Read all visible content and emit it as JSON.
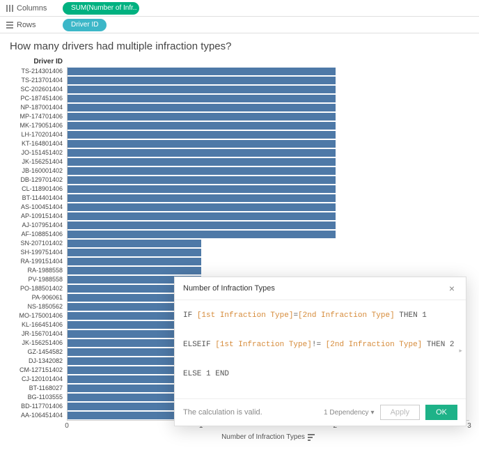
{
  "shelves": {
    "columns_label": "Columns",
    "rows_label": "Rows",
    "columns_pill": "SUM(Number of Infr..",
    "rows_pill": "Driver ID"
  },
  "viz": {
    "title": "How many drivers had multiple infraction types?",
    "y_header": "Driver ID",
    "x_label": "Number of Infraction Types"
  },
  "x_axis": {
    "ticks": [
      "0",
      "1",
      "2",
      "3"
    ],
    "max": 3
  },
  "chart_data": {
    "type": "bar",
    "xlabel": "Number of Infraction Types",
    "ylabel": "Driver ID",
    "xlim": [
      0,
      3
    ],
    "categories": [
      "TS-214301406",
      "TS-213701404",
      "SC-202601404",
      "PC-187451406",
      "NP-187001404",
      "MP-174701406",
      "MK-179051406",
      "LH-170201404",
      "KT-164801404",
      "JO-151451402",
      "JK-156251404",
      "JB-160001402",
      "DB-129701402",
      "CL-118901406",
      "BT-114401404",
      "AS-100451404",
      "AP-109151404",
      "AJ-107951404",
      "AF-108851406",
      "SN-207101402",
      "SH-199751404",
      "RA-199151404",
      "RA-1988558",
      "PV-1988558",
      "PO-188501402",
      "PA-906061",
      "NS-1850562",
      "MO-175001406",
      "KL-166451406",
      "JR-156701404",
      "JK-156251406",
      "GZ-1454582",
      "DJ-1342082",
      "CM-127151402",
      "CJ-120101404",
      "BT-1168027",
      "BG-1103555",
      "BD-117701406",
      "AA-106451404"
    ],
    "values": [
      2,
      2,
      2,
      2,
      2,
      2,
      2,
      2,
      2,
      2,
      2,
      2,
      2,
      2,
      2,
      2,
      2,
      2,
      2,
      1,
      1,
      1,
      1,
      1,
      1,
      1,
      1,
      1,
      1,
      1,
      1,
      1,
      1,
      1,
      1,
      1,
      1,
      1,
      1
    ]
  },
  "calc": {
    "title": "Number of Infraction Types",
    "line1_kw1": "IF",
    "line1_f1": "[1st Infraction Type]",
    "line1_eq": "=",
    "line1_f2": "[2nd Infraction Type]",
    "line1_kw2": "THEN",
    "line1_v": "1",
    "line2_kw1": "ELSEIF",
    "line2_f1": "[1st Infraction Type]",
    "line2_ne": "!=",
    "line2_f2": "[2nd Infraction Type]",
    "line2_kw2": "THEN",
    "line2_v": "2",
    "line3_kw1": "ELSE",
    "line3_v": "1",
    "line3_kw2": "END",
    "valid_msg": "The calculation is valid.",
    "dep_label": "1 Dependency",
    "apply_label": "Apply",
    "ok_label": "OK"
  }
}
